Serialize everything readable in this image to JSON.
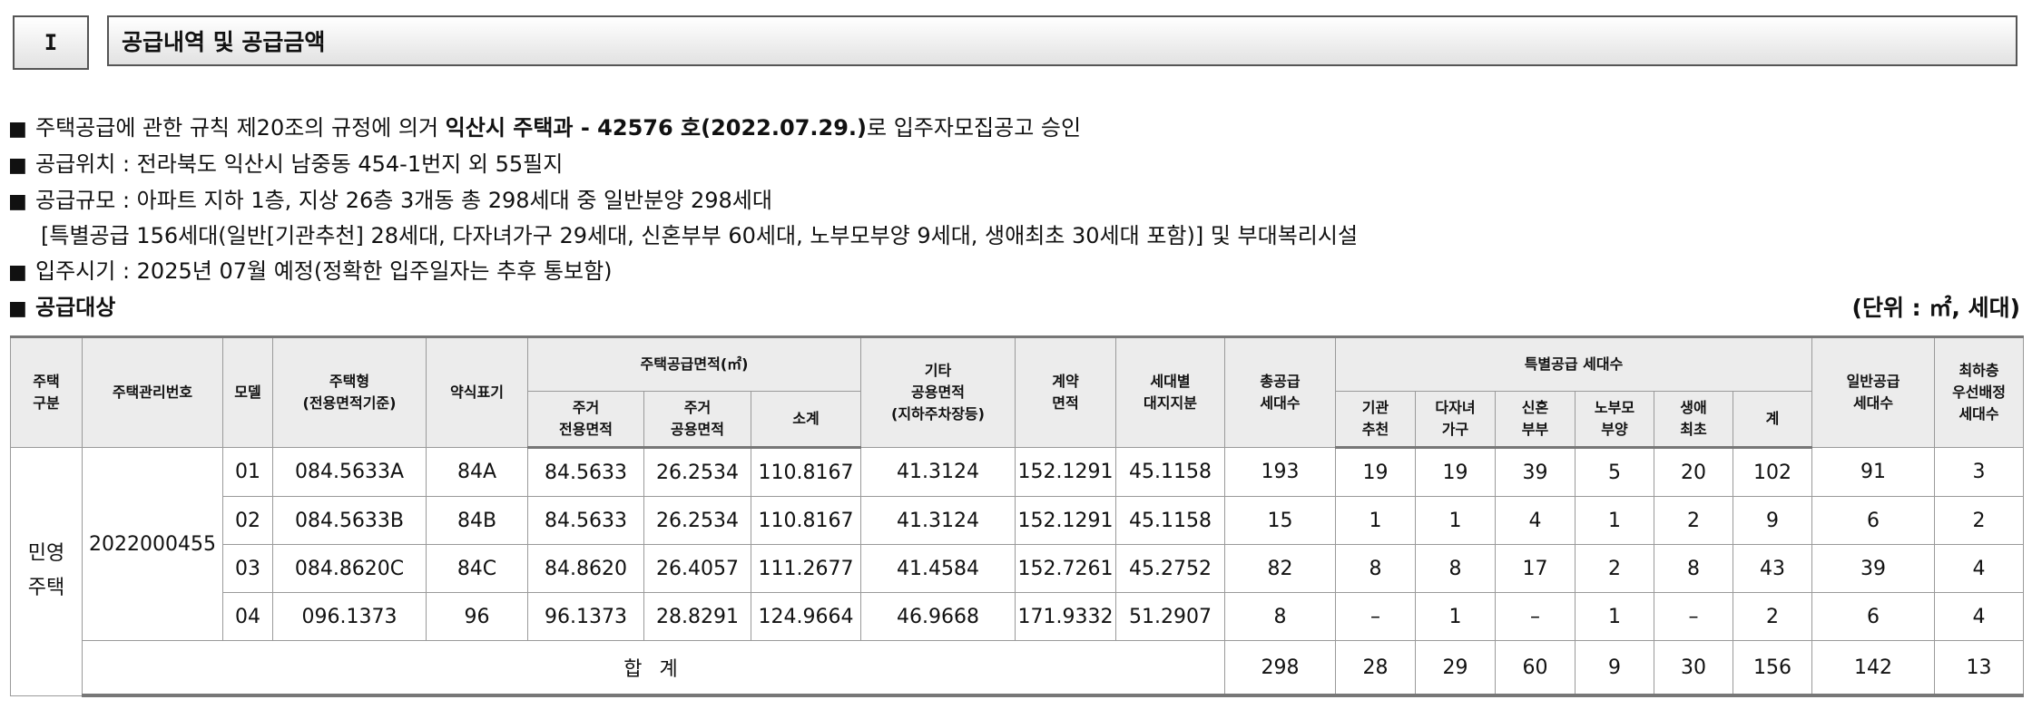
{
  "section": {
    "number": "I",
    "title": "공급내역 및 공급금액"
  },
  "info": {
    "bullet": "■",
    "line1": {
      "pre": "주택공급에 관한 규칙 제20조의 규정에 의거 ",
      "bold": "익산시 주택과 -  42576 호(2022.07.29.)",
      "post": "로 입주자모집공고 승인"
    },
    "line2": "공급위치 : 전라북도 익산시 남중동 454-1번지 외 55필지",
    "line3": "공급규모 : 아파트 지하 1층, 지상 26층 3개동 총 298세대 중 일반분양 298세대",
    "line4": "[특별공급 156세대(일반[기관추천] 28세대, 다자녀가구 29세대, 신혼부부 60세대, 노부모부양 9세대, 생애최초 30세대 포함)] 및 부대복리시설",
    "line5": "입주시기 : 2025년 07월 예정(정확한 입주일자는 추후 통보함)",
    "line6": "공급대상",
    "unit": "(단위 :  ㎡, 세대)"
  },
  "table": {
    "headers": {
      "house_type_group": "주택\n구분",
      "mgmt_no": "주택관리번호",
      "model": "모델",
      "house_type": "주택형\n(전용면적기준)",
      "abbr": "약식표기",
      "area_group": "주택공급면적(㎡)",
      "exclusive": "주거\n전용면적",
      "common": "주거\n공용면적",
      "subtotal": "소계",
      "other_common": "기타\n공용면적\n(지하주차장등)",
      "contract_area": "계약\n면적",
      "land_share": "세대별\n대지지분",
      "total_supply": "총공급\n세대수",
      "special_group": "특별공급 세대수",
      "institution": "기관\n추천",
      "multi_child": "다자녀\n가구",
      "newlywed": "신혼\n부부",
      "elderly": "노부모\n부양",
      "first_life": "생애\n최초",
      "special_sum": "계",
      "general": "일반공급\n세대수",
      "lowest_floor": "최하층\n우선배정\n세대수"
    },
    "group_label": "민영\n주택",
    "mgmt_number": "2022000455",
    "rows": [
      {
        "model": "01",
        "type": "084.5633A",
        "abbr": "84A",
        "exclusive": "84.5633",
        "common": "26.2534",
        "subtotal": "110.8167",
        "other": "41.3124",
        "contract": "152.1291",
        "land": "45.1158",
        "total": "193",
        "inst": "19",
        "multi": "19",
        "newly": "39",
        "elder": "5",
        "first": "20",
        "sum": "102",
        "general": "91",
        "lowest": "3"
      },
      {
        "model": "02",
        "type": "084.5633B",
        "abbr": "84B",
        "exclusive": "84.5633",
        "common": "26.2534",
        "subtotal": "110.8167",
        "other": "41.3124",
        "contract": "152.1291",
        "land": "45.1158",
        "total": "15",
        "inst": "1",
        "multi": "1",
        "newly": "4",
        "elder": "1",
        "first": "2",
        "sum": "9",
        "general": "6",
        "lowest": "2"
      },
      {
        "model": "03",
        "type": "084.8620C",
        "abbr": "84C",
        "exclusive": "84.8620",
        "common": "26.4057",
        "subtotal": "111.2677",
        "other": "41.4584",
        "contract": "152.7261",
        "land": "45.2752",
        "total": "82",
        "inst": "8",
        "multi": "8",
        "newly": "17",
        "elder": "2",
        "first": "8",
        "sum": "43",
        "general": "39",
        "lowest": "4"
      },
      {
        "model": "04",
        "type": "096.1373",
        "abbr": "96",
        "exclusive": "96.1373",
        "common": "28.8291",
        "subtotal": "124.9664",
        "other": "46.9668",
        "contract": "171.9332",
        "land": "51.2907",
        "total": "8",
        "inst": "–",
        "multi": "1",
        "newly": "–",
        "elder": "1",
        "first": "–",
        "sum": "2",
        "general": "6",
        "lowest": "4"
      }
    ],
    "total_row": {
      "label": "합 계",
      "total": "298",
      "inst": "28",
      "multi": "29",
      "newly": "60",
      "elder": "9",
      "first": "30",
      "sum": "156",
      "general": "142",
      "lowest": "13"
    }
  }
}
